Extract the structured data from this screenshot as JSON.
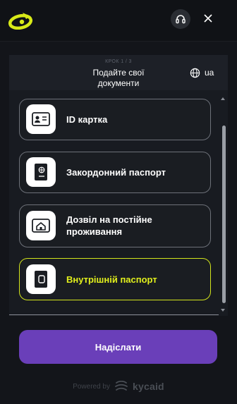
{
  "header": {
    "step": "КРОК 1 / 3",
    "title": "Подайте свої документи",
    "language": "ua"
  },
  "options": [
    {
      "label": "ID картка",
      "icon": "id-card-icon",
      "active": false
    },
    {
      "label": "Закордонний паспорт",
      "icon": "passport-icon",
      "active": false
    },
    {
      "label": "Дозвіл на постійне проживання",
      "icon": "residence-permit-icon",
      "active": false
    },
    {
      "label": "Внутрішній паспорт",
      "icon": "internal-passport-icon",
      "active": true
    }
  ],
  "submit_label": "Надіслати",
  "footer": {
    "powered_by": "Powered by",
    "brand": "kycaid"
  },
  "colors": {
    "background": "#13151a",
    "accent": "#6a3fb9",
    "highlight": "#d3e51c"
  }
}
